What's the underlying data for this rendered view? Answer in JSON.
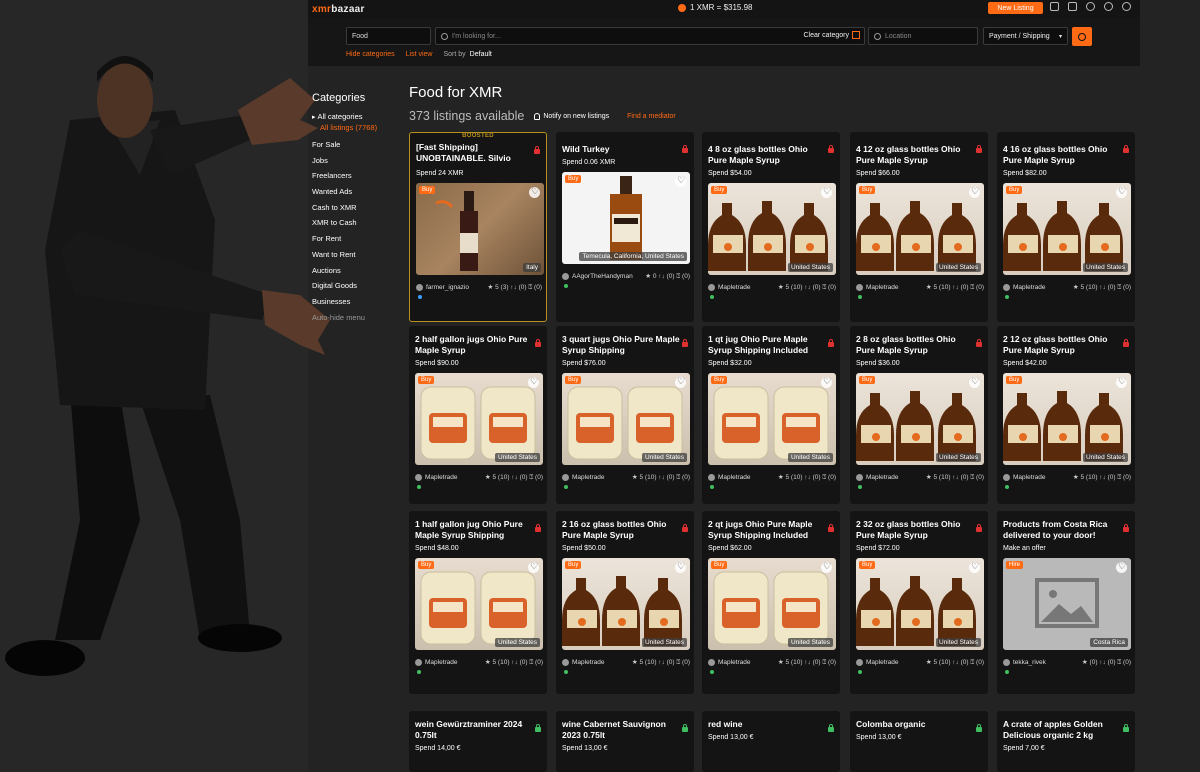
{
  "site": {
    "logo_prefix": "xmr",
    "logo_suffix": "bazaar",
    "price": "1 XMR = $315.98",
    "new_listing": "New Listing"
  },
  "search": {
    "category": "Food",
    "placeholder": "I'm looking for...",
    "clear": "Clear category",
    "location_placeholder": "Location",
    "payment": "Payment / Shipping"
  },
  "sublinks": {
    "hide": "Hide categories",
    "list": "List view",
    "sort_label": "Sort by",
    "sort_value": "Default"
  },
  "sidebar": {
    "title": "Categories",
    "all": "All categories",
    "all_listings": "All listings (7768)",
    "items": [
      "For Sale",
      "Jobs",
      "Freelancers",
      "Wanted Ads",
      "Cash to XMR",
      "XMR to Cash",
      "For Rent",
      "Want to Rent",
      "Auctions",
      "Digital Goods",
      "Businesses",
      "Auto-hide menu"
    ]
  },
  "main": {
    "title": "Food for XMR",
    "count": "373 listings available",
    "notify": "Notify on new listings",
    "mediator": "Find a mediator"
  },
  "colors": {
    "accent": "#ff6a14",
    "boost": "#b8901e",
    "lock_red": "#e03030",
    "lock_green": "#3fbf5f"
  },
  "cards": [
    {
      "title": "[Fast Shipping] UNOBTAINABLE. Silvio",
      "spend": "Spend 24 XMR",
      "tag": "Buy",
      "country": "Italy",
      "seller": "farmer_ignazio",
      "stats": "★ 5 (3)  ↑↓ (0)  ⍰ (0)",
      "boosted": "BOOSTED",
      "img": "wine"
    },
    {
      "title": "Wild Turkey",
      "spend": "Spend 0.06 XMR",
      "tag": "Buy",
      "country": "Temecula, California, United States",
      "seller": "AAgorTheHandyman",
      "stats": "★ 0  ↑↓ (0)  ⍰ (0)",
      "img": "turkey"
    },
    {
      "title": "4 8 oz glass bottles Ohio Pure Maple Syrup",
      "spend": "Spend $54.00",
      "tag": "Buy",
      "country": "United States",
      "seller": "Mapletrade",
      "stats": "★ 5 (10)  ↑↓ (0)  ⍰ (0)",
      "img": "syrup"
    },
    {
      "title": "4 12 oz glass bottles Ohio Pure Maple Syrup",
      "spend": "Spend $66.00",
      "tag": "Buy",
      "country": "United States",
      "seller": "Mapletrade",
      "stats": "★ 5 (10)  ↑↓ (0)  ⍰ (0)",
      "img": "syrup"
    },
    {
      "title": "4 16 oz glass bottles Ohio Pure Maple Syrup",
      "spend": "Spend $82.00",
      "tag": "Buy",
      "country": "United States",
      "seller": "Mapletrade",
      "stats": "★ 5 (10)  ↑↓ (0)  ⍰ (0)",
      "img": "syrup"
    },
    {
      "title": "2 half gallon jugs Ohio Pure Maple Syrup",
      "spend": "Spend $90.00",
      "tag": "Buy",
      "country": "United States",
      "seller": "Mapletrade",
      "stats": "★ 5 (10)  ↑↓ (0)  ⍰ (0)",
      "img": "jug"
    },
    {
      "title": "3 quart jugs Ohio Pure Maple Syrup Shipping",
      "spend": "Spend $76.00",
      "tag": "Buy",
      "country": "United States",
      "seller": "Mapletrade",
      "stats": "★ 5 (10)  ↑↓ (0)  ⍰ (0)",
      "img": "jug"
    },
    {
      "title": "1 qt jug Ohio Pure Maple Syrup Shipping Included",
      "spend": "Spend $32.00",
      "tag": "Buy",
      "country": "United States",
      "seller": "Mapletrade",
      "stats": "★ 5 (10)  ↑↓ (0)  ⍰ (0)",
      "img": "jug"
    },
    {
      "title": "2 8 oz glass bottles Ohio Pure Maple Syrup",
      "spend": "Spend $36.00",
      "tag": "Buy",
      "country": "United States",
      "seller": "Mapletrade",
      "stats": "★ 5 (10)  ↑↓ (0)  ⍰ (0)",
      "img": "syrup"
    },
    {
      "title": "2 12 oz glass bottles Ohio Pure Maple Syrup",
      "spend": "Spend $42.00",
      "tag": "Buy",
      "country": "United States",
      "seller": "Mapletrade",
      "stats": "★ 5 (10)  ↑↓ (0)  ⍰ (0)",
      "img": "syrup"
    },
    {
      "title": "1 half gallon jug Ohio Pure Maple Syrup Shipping",
      "spend": "Spend $48.00",
      "tag": "Buy",
      "country": "United States",
      "seller": "Mapletrade",
      "stats": "★ 5 (10)  ↑↓ (0)  ⍰ (0)",
      "img": "jug"
    },
    {
      "title": "2 16 oz glass bottles Ohio Pure Maple Syrup",
      "spend": "Spend $50.00",
      "tag": "Buy",
      "country": "United States",
      "seller": "Mapletrade",
      "stats": "★ 5 (10)  ↑↓ (0)  ⍰ (0)",
      "img": "syrup"
    },
    {
      "title": "2 qt jugs Ohio Pure Maple Syrup Shipping Included",
      "spend": "Spend $62.00",
      "tag": "Buy",
      "country": "United States",
      "seller": "Mapletrade",
      "stats": "★ 5 (10)  ↑↓ (0)  ⍰ (0)",
      "img": "jug"
    },
    {
      "title": "2 32 oz glass bottles Ohio Pure Maple Syrup",
      "spend": "Spend $72.00",
      "tag": "Buy",
      "country": "United States",
      "seller": "Mapletrade",
      "stats": "★ 5 (10)  ↑↓ (0)  ⍰ (0)",
      "img": "syrup"
    },
    {
      "title": "Products from Costa Rica delivered to your door!",
      "spend": "Make an offer",
      "tag": "Hire",
      "country": "Costa Rica",
      "seller": "tekka_rivek",
      "stats": "★ (0)  ↑↓ (0)  ⍰ (0)",
      "img": "placeholder"
    },
    {
      "title": "wein Gewürztraminer 2024 0.75lt",
      "spend": "Spend 14,00 €",
      "lock": "green"
    },
    {
      "title": "wine Cabernet Sauvignon 2023 0.75lt",
      "spend": "Spend 13,00 €",
      "lock": "green"
    },
    {
      "title": "red wine",
      "spend": "Spend 13,00 €",
      "lock": "green"
    },
    {
      "title": "Colomba organic",
      "spend": "Spend 13,00 €",
      "lock": "green"
    },
    {
      "title": "A crate of apples Golden Delicious organic 2 kg",
      "spend": "Spend 7,00 €",
      "lock": "green"
    }
  ]
}
